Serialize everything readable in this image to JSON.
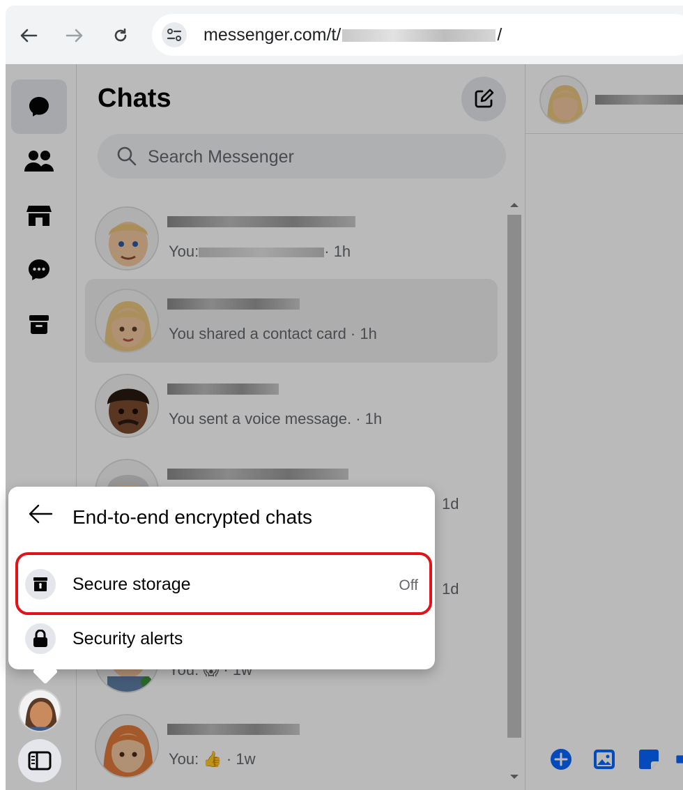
{
  "browser": {
    "back_icon": "arrow-left-icon",
    "forward_icon": "arrow-right-icon",
    "reload_icon": "reload-icon",
    "url_prefix": "messenger.com/t/",
    "url_suffix": "/"
  },
  "rail": {
    "items": [
      {
        "name": "chats",
        "icon": "chat-bubble-icon",
        "active": true
      },
      {
        "name": "people",
        "icon": "people-icon"
      },
      {
        "name": "marketplace",
        "icon": "store-icon"
      },
      {
        "name": "message-requests",
        "icon": "message-request-icon"
      },
      {
        "name": "archive",
        "icon": "archive-icon"
      }
    ]
  },
  "chats": {
    "title": "Chats",
    "search_placeholder": "Search Messenger",
    "rows": [
      {
        "preview_prefix": "You:",
        "preview_suffix": "· 1h"
      },
      {
        "preview": "You shared a contact card · 1h"
      },
      {
        "preview": "You sent a voice message. · 1h"
      },
      {
        "preview_tail": "1d"
      },
      {
        "preview_tail": "1d"
      },
      {
        "preview": "You: 😱 · 1w"
      },
      {
        "preview_prefix": "You:",
        "preview_suffix": "· 1w"
      }
    ]
  },
  "popover": {
    "title": "End-to-end encrypted chats",
    "items": [
      {
        "label": "Secure storage",
        "value": "Off",
        "icon": "secure-storage-icon"
      },
      {
        "label": "Security alerts",
        "icon": "lock-icon"
      }
    ]
  },
  "colors": {
    "accent": "#0866ff",
    "highlight": "#e0121a"
  }
}
